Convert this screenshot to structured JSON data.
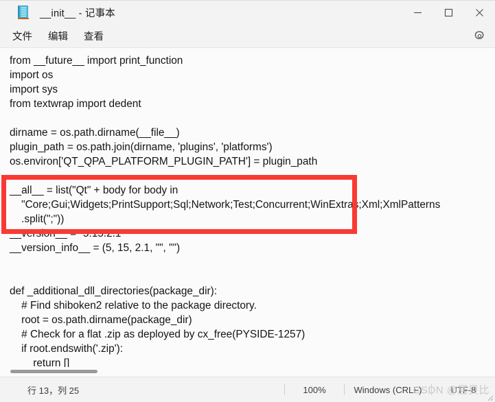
{
  "window": {
    "title": "__init__ - 记事本",
    "icon": "notepad-icon",
    "minimize_label": "—",
    "maximize_label": "□",
    "close_label": "✕"
  },
  "menubar": {
    "items": [
      {
        "label": "文件"
      },
      {
        "label": "编辑"
      },
      {
        "label": "查看"
      }
    ],
    "settings_icon": "gear-icon"
  },
  "editor": {
    "lines": [
      "from __future__ import print_function",
      "import os",
      "import sys",
      "from textwrap import dedent",
      "",
      "dirname = os.path.dirname(__file__)",
      "plugin_path = os.path.join(dirname, 'plugins', 'platforms')",
      "os.environ['QT_QPA_PLATFORM_PLUGIN_PATH'] = plugin_path",
      "",
      "__all__ = list(\"Qt\" + body for body in",
      "    \"Core;Gui;Widgets;PrintSupport;Sql;Network;Test;Concurrent;WinExtras;Xml;XmlPatterns",
      "    .split(\";\"))",
      "__version__ = \"5.15.2.1\"",
      "__version_info__ = (5, 15, 2.1, \"\", \"\")",
      "",
      "",
      "def _additional_dll_directories(package_dir):",
      "    # Find shiboken2 relative to the package directory.",
      "    root = os.path.dirname(package_dir)",
      "    # Check for a flat .zip as deployed by cx_free(PYSIDE-1257)",
      "    if root.endswith('.zip'):",
      "        return []"
    ],
    "annotation": {
      "type": "red-rectangle",
      "color": "#f93a33",
      "covers_lines": [
        "dirname = os.path.dirname(__file__)",
        "plugin_path = os.path.join(dirname, 'plugins', 'platforms')",
        "os.environ['QT_QPA_PLATFORM_PLUGIN_PATH'] = plugin_path"
      ]
    }
  },
  "statusbar": {
    "cursor_position": "行 13，列 25",
    "zoom": "100%",
    "line_ending": "Windows (CRLF)",
    "encoding": "UTF-8",
    "watermark": "CSDN @居贝比"
  }
}
